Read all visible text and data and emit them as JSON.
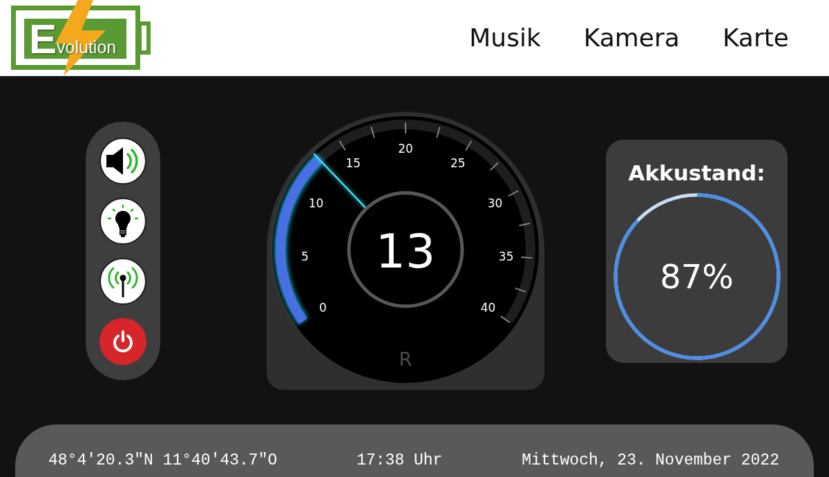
{
  "header": {
    "logo": {
      "initial": "E",
      "text": "volution"
    },
    "nav": [
      {
        "label": "Musik"
      },
      {
        "label": "Kamera"
      },
      {
        "label": "Karte"
      }
    ]
  },
  "controls": [
    {
      "kind": "sound"
    },
    {
      "kind": "light"
    },
    {
      "kind": "signal"
    },
    {
      "kind": "power"
    }
  ],
  "gauge": {
    "scale_labels": [
      "0",
      "5",
      "10",
      "15",
      "20",
      "25",
      "30",
      "35",
      "40"
    ],
    "value": "13",
    "level": 0.325,
    "gear": "R"
  },
  "battery": {
    "title": "Akkustand:",
    "reading": "87%",
    "level": 0.87
  },
  "status_bar": {
    "coordinates": "48°4'20.3\"N 11°40'43.7\"O",
    "time": "17:38 Uhr",
    "date": "Mittwoch, 23. November 2022"
  }
}
